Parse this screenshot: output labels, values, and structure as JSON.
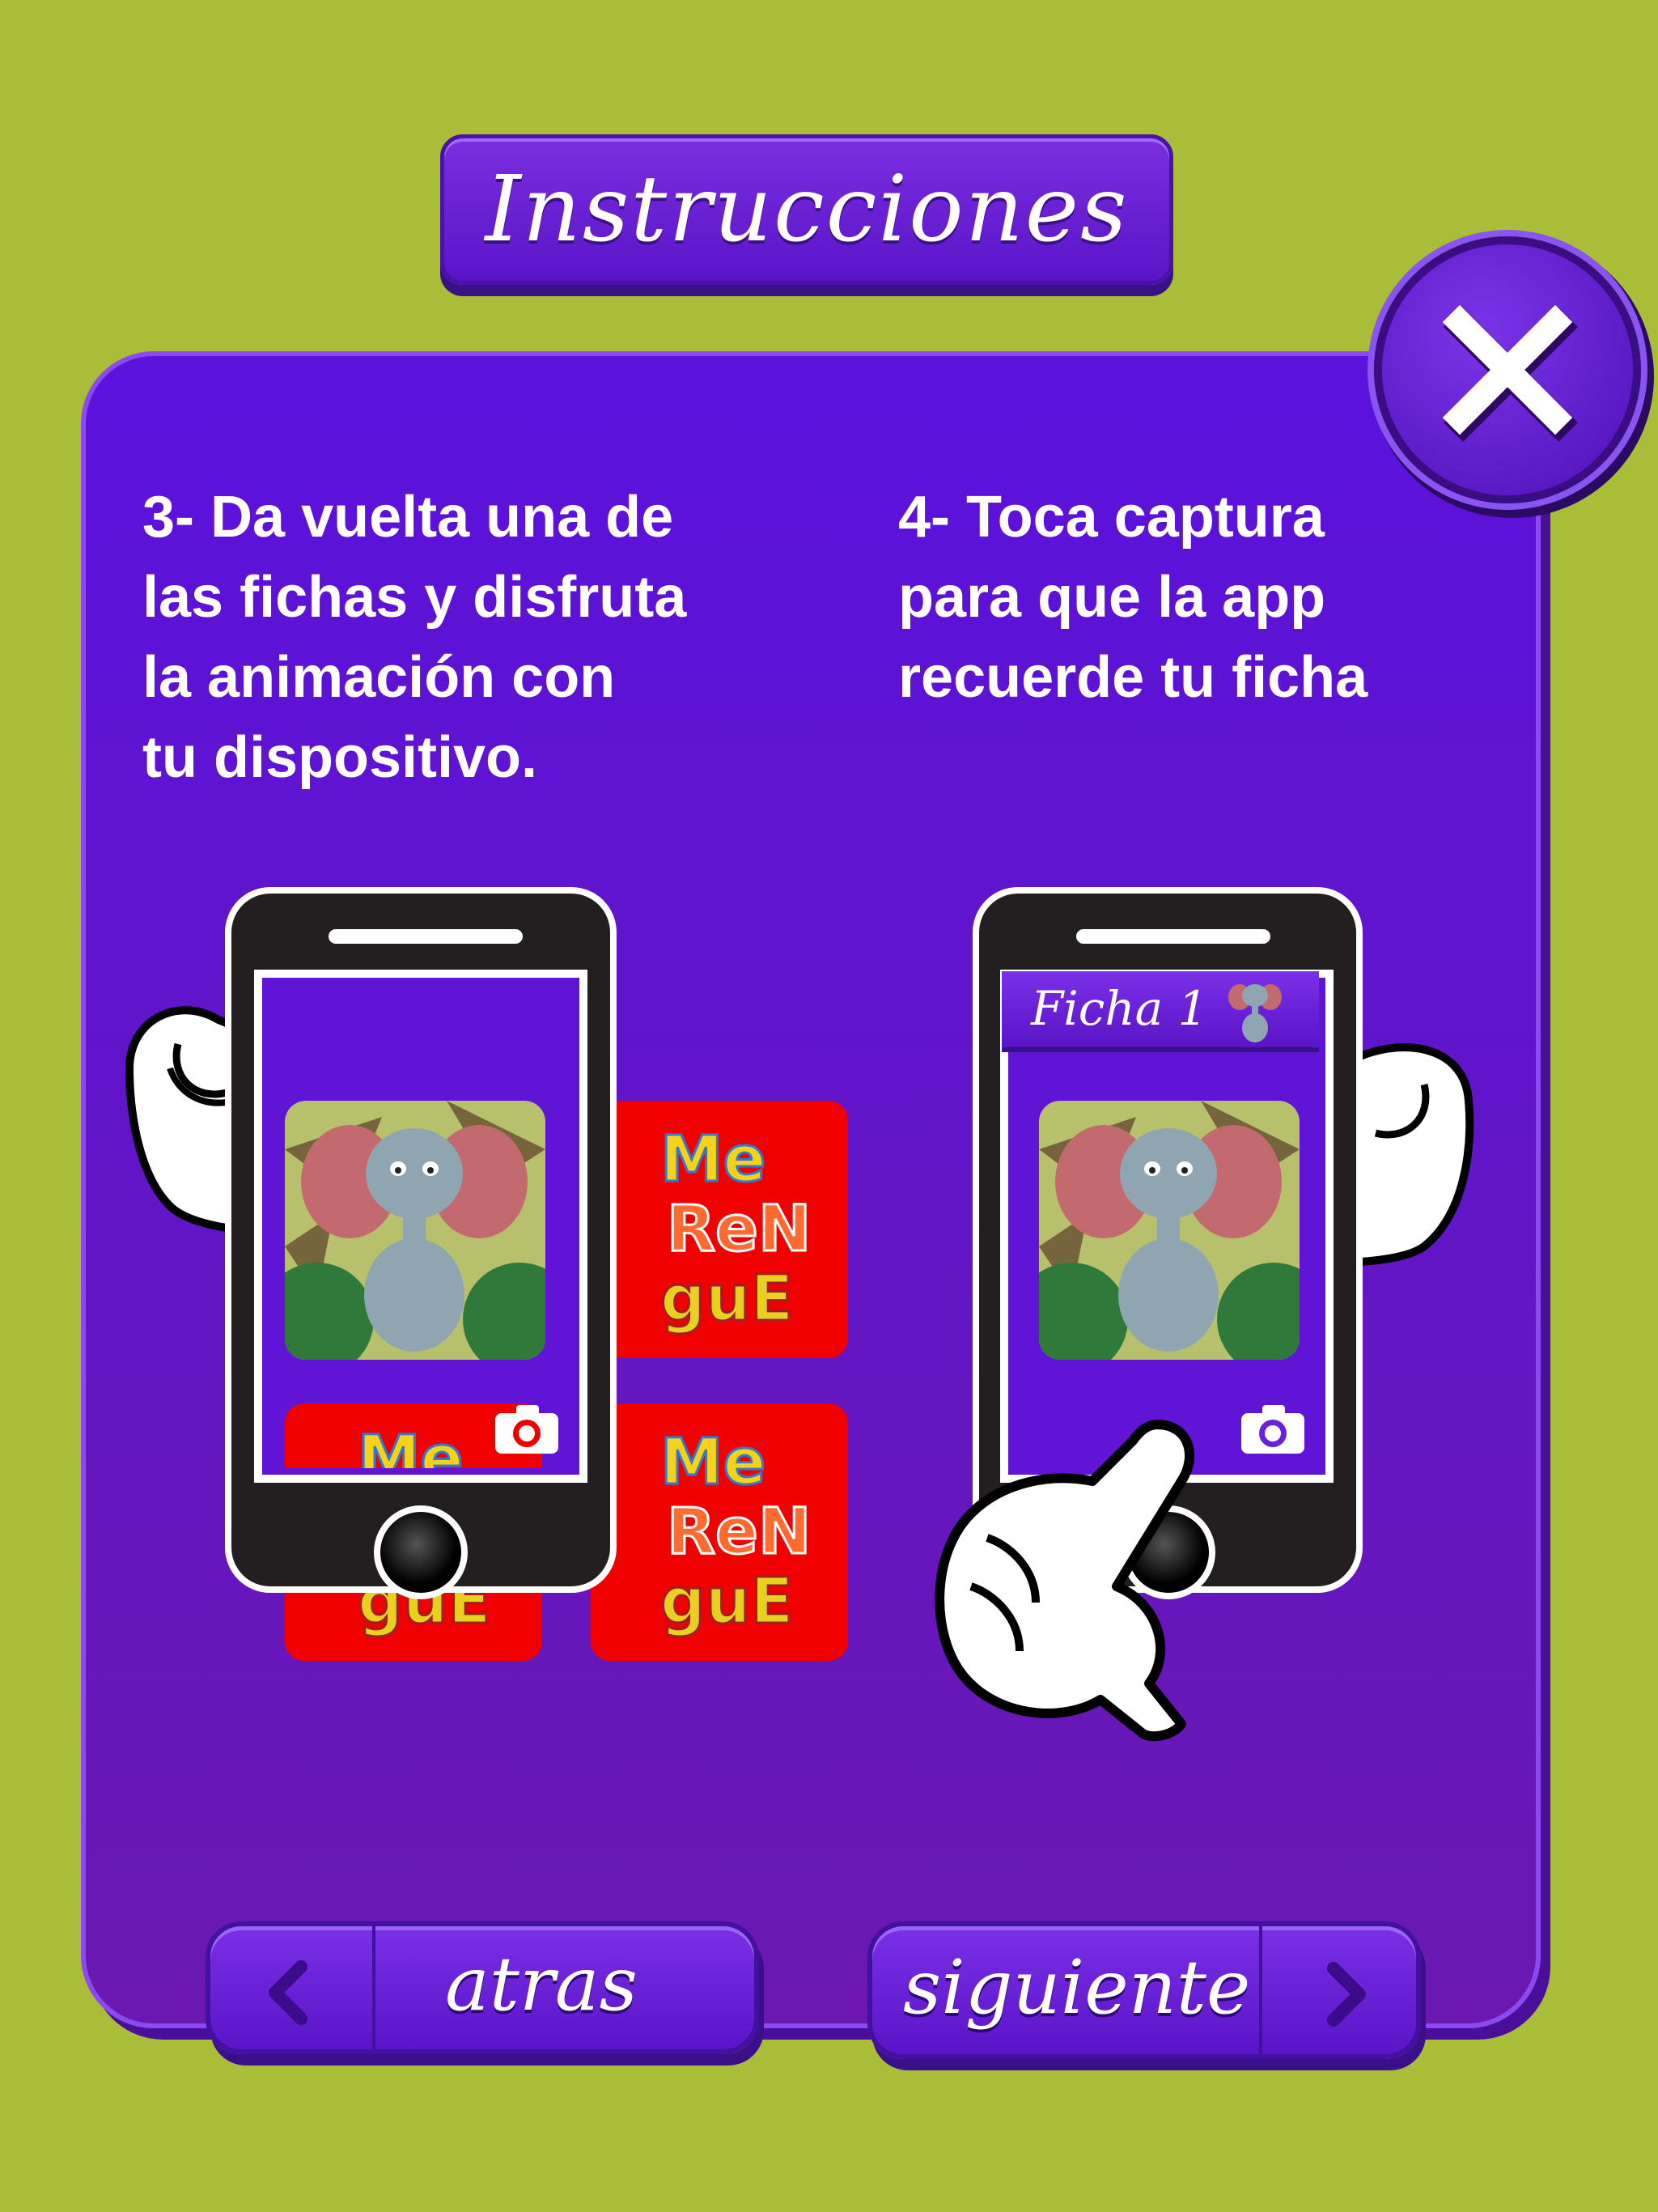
{
  "header": {
    "title": "Instrucciones"
  },
  "steps": [
    {
      "text": "3-  Da vuelta una de\nlas fichas y disfruta\nla animación con\ntu dispositivo."
    },
    {
      "text": "4- Toca captura\npara que la app\nrecuerde tu ficha"
    }
  ],
  "phone2": {
    "card_label": "Ficha 1"
  },
  "brand": {
    "logo_lines": [
      "Me",
      "ReN",
      "guE"
    ]
  },
  "nav": {
    "back_label": "atras",
    "next_label": "siguiente"
  },
  "colors": {
    "background": "#a9bd38",
    "panel": "#5a12dd",
    "card_red": "#f10000",
    "button": "#6a22d8"
  },
  "icons": [
    "close-icon",
    "camera-icon",
    "chevron-left-icon",
    "chevron-right-icon",
    "hand-icon",
    "elephant-illustration"
  ]
}
